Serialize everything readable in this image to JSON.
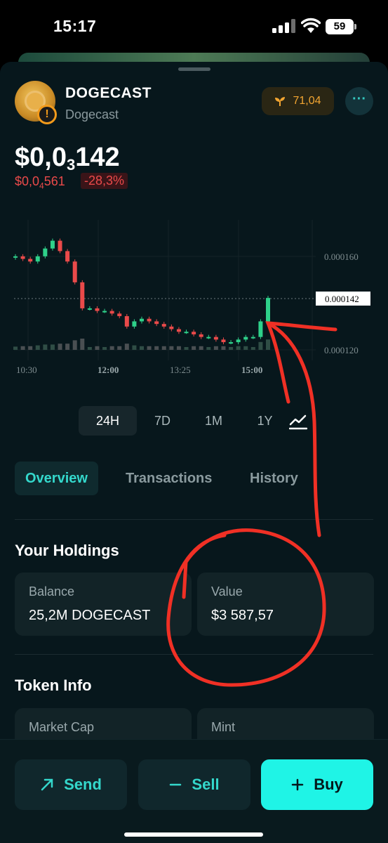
{
  "status": {
    "time": "15:17",
    "battery": "59"
  },
  "token": {
    "symbol": "DOGECAST",
    "name": "Dogecast",
    "score": "71,04",
    "price_prefix": "$0,0",
    "price_zero_count": "3",
    "price_digits": "142",
    "low_prefix": "$0,0",
    "low_zero_count": "4",
    "low_digits": "561",
    "change": "-28,3%"
  },
  "chart_data": {
    "type": "candlestick",
    "x_ticks": [
      "10:30",
      "12:00",
      "13:25",
      "15:00"
    ],
    "y_ticks": [
      "0.000160",
      "0.000120"
    ],
    "current_price_label": "0.000142",
    "closes": [
      0.000158,
      0.000157,
      0.000156,
      0.000158,
      0.000161,
      0.000164,
      0.00016,
      0.000156,
      0.000148,
      0.000138,
      0.000138,
      0.000137,
      0.000137,
      0.000136,
      0.000135,
      0.000131,
      0.000133,
      0.000134,
      0.000133,
      0.000132,
      0.000131,
      0.00013,
      0.000129,
      0.000129,
      0.000128,
      0.000127,
      0.000127,
      0.000126,
      0.000125,
      0.000125,
      0.000126,
      0.000127,
      0.000127,
      0.000133,
      0.000142
    ],
    "colors": {
      "up": "#2ed18a",
      "down": "#ea4a4a"
    }
  },
  "timeframes": [
    "24H",
    "7D",
    "1M",
    "1Y"
  ],
  "tabs": [
    "Overview",
    "Transactions",
    "History"
  ],
  "holdings": {
    "title": "Your Holdings",
    "balance_label": "Balance",
    "balance_value": "25,2M DOGECAST",
    "value_label": "Value",
    "value_value": "$3 587,57"
  },
  "token_info": {
    "title": "Token Info",
    "market_cap_label": "Market Cap",
    "mint_label": "Mint"
  },
  "actions": {
    "send": "Send",
    "sell": "Sell",
    "buy": "Buy"
  },
  "colors": {
    "accent": "#1ff4e6",
    "background": "#07171c",
    "negative": "#ea4a4a",
    "positive": "#2ed18a"
  }
}
